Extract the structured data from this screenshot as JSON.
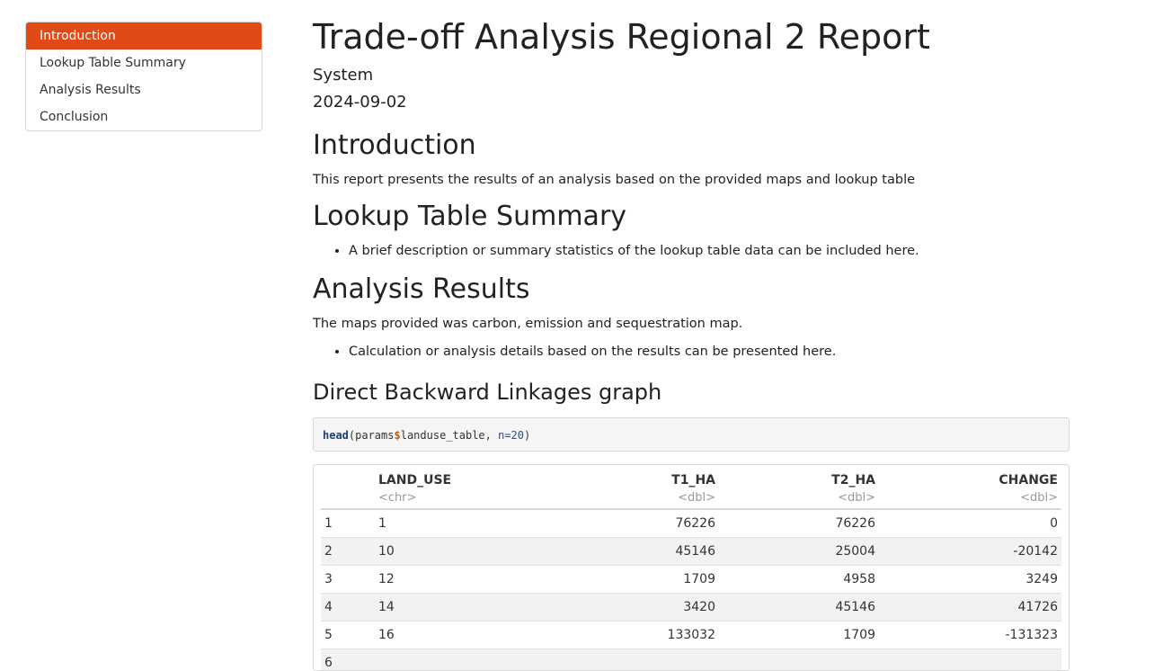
{
  "toc": {
    "items": [
      {
        "label": "Introduction",
        "active": true
      },
      {
        "label": "Lookup Table Summary"
      },
      {
        "label": "Analysis Results"
      },
      {
        "label": "Conclusion"
      }
    ]
  },
  "header": {
    "title": "Trade-off Analysis Regional 2 Report",
    "author": "System",
    "date": "2024-09-02"
  },
  "intro": {
    "heading": "Introduction",
    "text": "This report presents the results of an analysis based on the provided maps and lookup table"
  },
  "lookup": {
    "heading": "Lookup Table Summary",
    "bullet": "A brief description or summary statistics of the lookup table data can be included here."
  },
  "analysis": {
    "heading": "Analysis Results",
    "text": "The maps provided was carbon, emission and sequestration map.",
    "bullet": "Calculation or analysis details based on the results can be presented here.",
    "subheading": "Direct Backward Linkages graph"
  },
  "code": {
    "fn": "head",
    "open": "(params",
    "op": "$",
    "obj": "landuse_table, ",
    "arg": "n=",
    "num": "20",
    "close": ")"
  },
  "table": {
    "columns": [
      {
        "name": "LAND_USE",
        "type": "<chr>"
      },
      {
        "name": "T1_HA",
        "type": "<dbl>"
      },
      {
        "name": "T2_HA",
        "type": "<dbl>"
      },
      {
        "name": "CHANGE",
        "type": "<dbl>"
      }
    ],
    "rows": [
      {
        "idx": "1",
        "land_use": "1",
        "t1": "76226",
        "t2": "76226",
        "change": "0"
      },
      {
        "idx": "2",
        "land_use": "10",
        "t1": "45146",
        "t2": "25004",
        "change": "-20142"
      },
      {
        "idx": "3",
        "land_use": "12",
        "t1": "1709",
        "t2": "4958",
        "change": "3249"
      },
      {
        "idx": "4",
        "land_use": "14",
        "t1": "3420",
        "t2": "45146",
        "change": "41726"
      },
      {
        "idx": "5",
        "land_use": "16",
        "t1": "133032",
        "t2": "1709",
        "change": "-131323"
      },
      {
        "idx": "6",
        "land_use": "",
        "t1": "",
        "t2": "",
        "change": ""
      }
    ]
  }
}
